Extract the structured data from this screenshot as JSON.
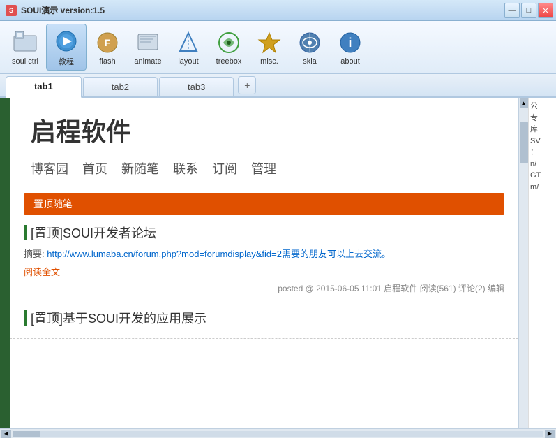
{
  "titleBar": {
    "icon": "S",
    "text": "SOUI演示 version:1.5",
    "controls": [
      "—",
      "□",
      "✕"
    ]
  },
  "toolbar": {
    "items": [
      {
        "id": "soui-ctrl",
        "label": "soui ctrl",
        "icon": "🏠",
        "active": false
      },
      {
        "id": "tutorial",
        "label": "教程",
        "icon": "⚙",
        "active": true
      },
      {
        "id": "flash",
        "label": "flash",
        "icon": "👤",
        "active": false
      },
      {
        "id": "animate",
        "label": "animate",
        "icon": "📰",
        "active": false
      },
      {
        "id": "layout",
        "label": "layout",
        "icon": "✦",
        "active": false
      },
      {
        "id": "treebox",
        "label": "treebox",
        "icon": "🔄",
        "active": false
      },
      {
        "id": "misc",
        "label": "misc.",
        "icon": "⬡",
        "active": false
      },
      {
        "id": "skia",
        "label": "skia",
        "icon": "🎧",
        "active": false
      },
      {
        "id": "about",
        "label": "about",
        "icon": "ℹ",
        "active": false
      }
    ]
  },
  "tabs": {
    "items": [
      {
        "id": "tab1",
        "label": "tab1",
        "active": true
      },
      {
        "id": "tab2",
        "label": "tab2",
        "active": false
      },
      {
        "id": "tab3",
        "label": "tab3",
        "active": false
      }
    ],
    "addButton": "+"
  },
  "blog": {
    "title": "启程软件",
    "nav": [
      "博客园",
      "首页",
      "新随笔",
      "联系",
      "订阅",
      "管理"
    ],
    "pinnedLabel": "置顶随笔",
    "posts": [
      {
        "id": "post1",
        "title": "[置顶]SOUI开发者论坛",
        "summaryPrefix": "摘要: ",
        "summaryLink": "http://www.lumaba.cn/forum.php?mod=forumdisplay&fid=2需要的朋友可以上去交流。",
        "readMore": "阅读全文",
        "meta": "posted @ 2015-06-05 11:01 启程软件 阅读(561) 评论(2) 编辑"
      },
      {
        "id": "post2",
        "title": "[置顶]基于SOUI开发的应用展示",
        "summaryPrefix": "",
        "summaryLink": "",
        "readMore": "",
        "meta": ""
      }
    ]
  },
  "rightPanel": {
    "lines": [
      "公",
      "专",
      "库",
      "SV",
      "：",
      "n/",
      "GT",
      "m/"
    ]
  }
}
